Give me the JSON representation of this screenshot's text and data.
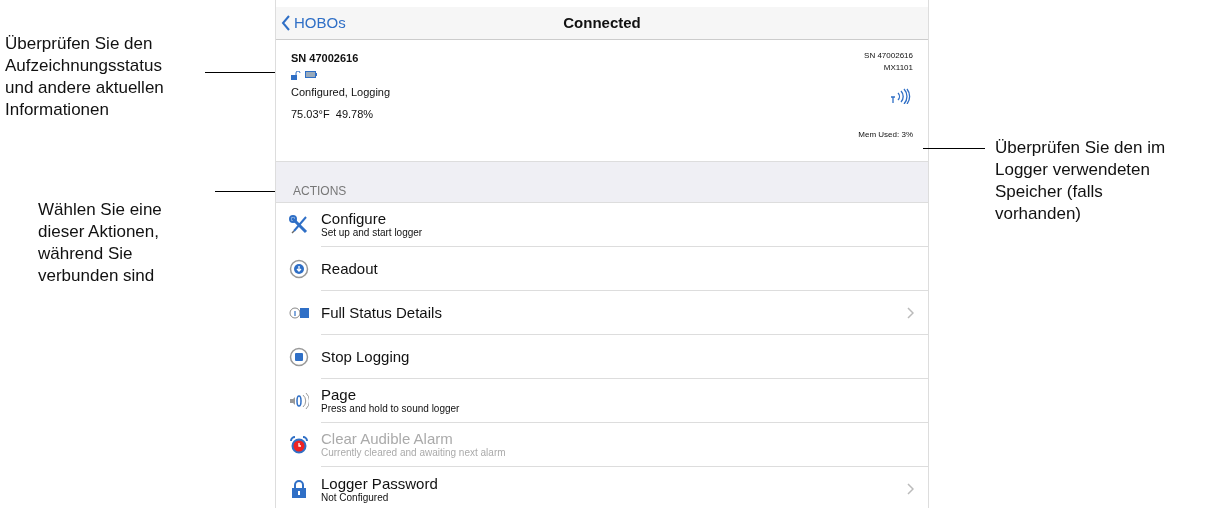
{
  "annotations_left": [
    {
      "text": "Überprüfen Sie den Aufzeichnungsstatus und andere aktuellen Informationen"
    },
    {
      "text": "Wählen Sie eine dieser Aktionen, während Sie verbunden sind"
    }
  ],
  "annotations_right": [
    {
      "text": "Überprüfen Sie den im Logger verwendeten Speicher (falls vorhanden)"
    }
  ],
  "nav": {
    "back": "HOBOs",
    "title": "Connected"
  },
  "logger": {
    "serial": "SN 47002616",
    "status": "Configured, Logging",
    "readings": "75.03°F  49.78%",
    "serial_right": "SN 47002616",
    "model": "MX1101",
    "memory": "Mem Used: 3%"
  },
  "section": "ACTIONS",
  "actions": [
    {
      "kind": "configure",
      "title": "Configure",
      "subtitle": "Set up and start logger",
      "disabled": false,
      "chevron": false
    },
    {
      "kind": "readout",
      "title": "Readout",
      "disabled": false,
      "chevron": false
    },
    {
      "kind": "status",
      "title": "Full Status Details",
      "disabled": false,
      "chevron": true
    },
    {
      "kind": "stop",
      "title": "Stop Logging",
      "disabled": false,
      "chevron": false
    },
    {
      "kind": "page",
      "title": "Page",
      "subtitle": "Press and hold to sound logger",
      "disabled": false,
      "chevron": false
    },
    {
      "kind": "alarm",
      "title": "Clear Audible Alarm",
      "subtitle": "Currently cleared and awaiting next alarm",
      "disabled": true,
      "chevron": false
    },
    {
      "kind": "password",
      "title": "Logger Password",
      "subtitle": "Not Configured",
      "disabled": false,
      "chevron": true
    }
  ]
}
